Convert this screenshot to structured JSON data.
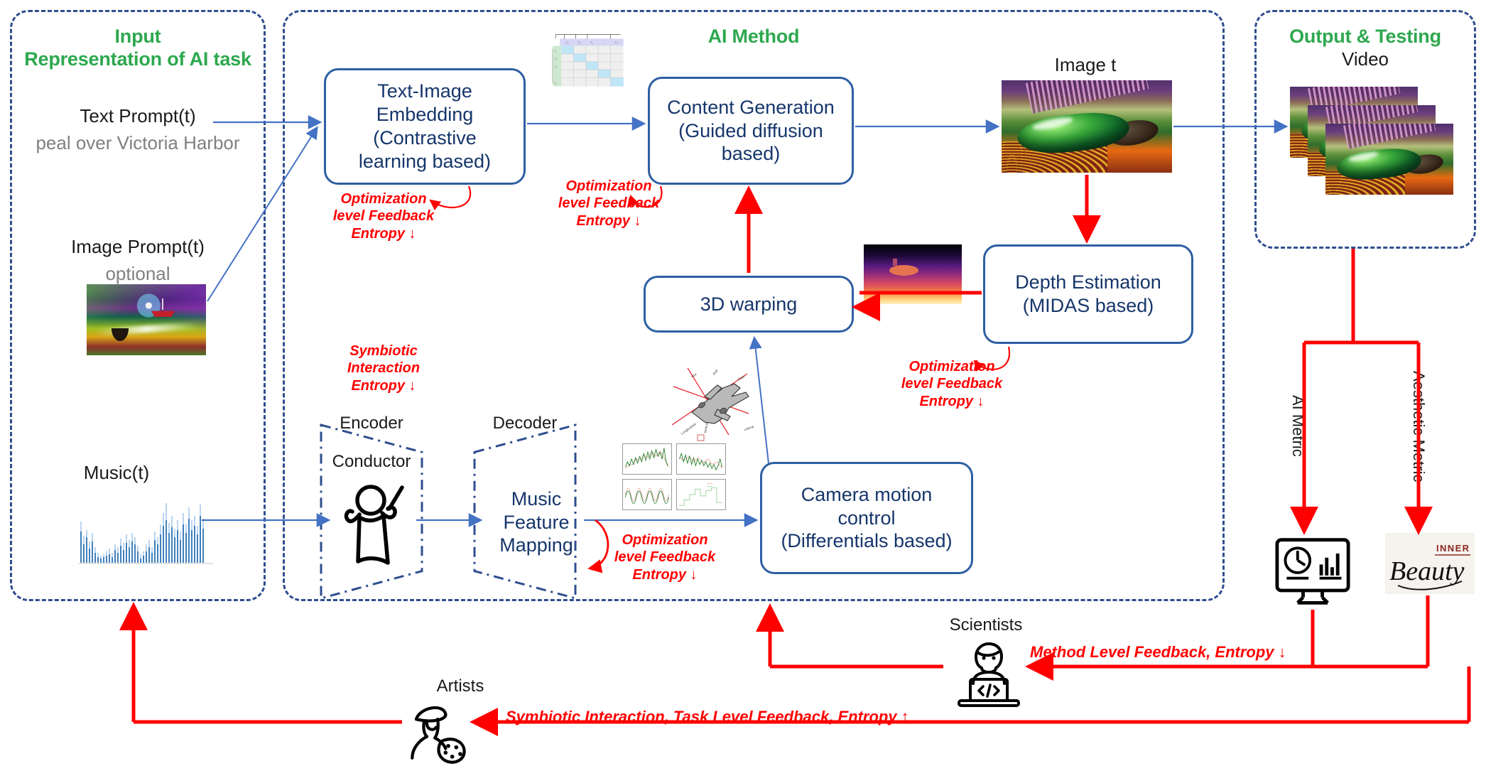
{
  "panels": {
    "input": {
      "title_line1": "Input",
      "title_line2": "Representation of AI task"
    },
    "method": {
      "title": "AI Method"
    },
    "output": {
      "title": "Output & Testing",
      "subtitle": "Video"
    }
  },
  "input": {
    "text_prompt_label": "Text Prompt(t)",
    "text_prompt_value": "peal over Victoria Harbor",
    "image_prompt_label": "Image Prompt(t)",
    "image_prompt_note": "optional",
    "music_label": "Music(t)"
  },
  "boxes": {
    "text_image_embedding": "Text-Image\nEmbedding\n(Contrastive\nlearning based)",
    "content_generation": "Content Generation\n(Guided diffusion\nbased)",
    "depth_estimation": "Depth Estimation\n(MIDAS based)",
    "warping_3d": "3D warping",
    "music_feature_mapping": "Music\nFeature\nMapping",
    "camera_motion_control": "Camera motion\ncontrol\n(Differentials based)"
  },
  "labels": {
    "encoder": "Encoder",
    "decoder": "Decoder",
    "conductor": "Conductor",
    "image_t": "Image t",
    "scientists": "Scientists",
    "artists": "Artists",
    "ai_metric": "AI Metric",
    "aesthetic_metric": "Aesthetic Metric",
    "inner_beauty_top": "INNER",
    "inner_beauty_main": "Beauty"
  },
  "feedback": {
    "embedding": "Optimization\nlevel Feedback\nEntropy ↓",
    "content_gen": "Optimization\nlevel Feedback\nEntropy ↓",
    "depth": "Optimization\nlevel Feedback\nEntropy ↓",
    "music_mapping": "Optimization\nlevel Feedback\nEntropy ↓",
    "camera_motion": "Optimization\nlevel Feedback\nEntropy ↓",
    "symbiotic_encoder": "Symbiotic\nInteraction\nEntropy ↓",
    "method_level": "Method Level Feedback, Entropy ↓",
    "task_level": "Symbiotic Interaction, Task Level Feedback, Entropy ↑"
  },
  "icons": {
    "conductor": "conductor-icon",
    "scientist": "scientist-laptop-icon",
    "artist": "artist-palette-icon",
    "ai_metric": "monitor-dashboard-icon",
    "aesthetic_metric": "inner-beauty-logo",
    "airplane_axes": "airplane-axes-icon",
    "clip_matrix": "contrastive-matrix-icon",
    "music_waveform": "music-waveform-icon",
    "motion_plots": "motion-signal-plots-icon",
    "depth_map": "depth-map-thumbnail",
    "harbor_image": "harbor-art-thumbnail",
    "generated_image": "generated-frame-thumbnail",
    "video_frames": "video-frame-stack"
  },
  "colors": {
    "panel_border": "#2E4E8F",
    "box_border": "#2E5FA3",
    "box_text": "#16366B",
    "title_green": "#2EA84F",
    "feedback_red": "#FF0000",
    "flow_blue": "#4472C4",
    "muted_grey": "#808080"
  }
}
